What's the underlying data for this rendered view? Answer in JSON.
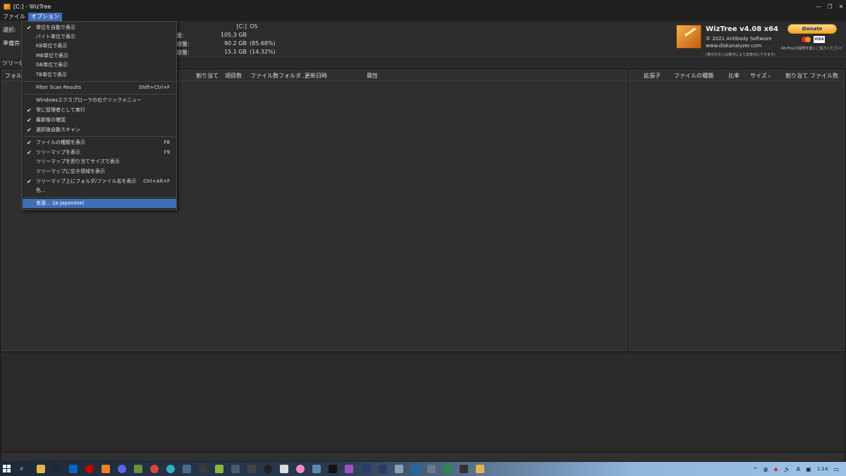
{
  "window": {
    "title": "[C:] - WizTree",
    "controls": {
      "minimize": "—",
      "maximize": "❐",
      "close": "✕"
    }
  },
  "menubar": {
    "file": "ファイル",
    "options": "オプション"
  },
  "info": {
    "select_label": "選択:",
    "ready_label": "準備完",
    "drive": {
      "row1": {
        "key": "",
        "value": "[C:]",
        "extra": "OS"
      },
      "row2": {
        "key": "量:",
        "value": "105.3 GB",
        "extra": ""
      },
      "row3": {
        "key": "容量:",
        "value": "90.2 GB",
        "extra": "(85.68%)"
      },
      "row4": {
        "key": "容量:",
        "value": "15.1 GB",
        "extra": "(14.32%)"
      }
    }
  },
  "brand": {
    "title": "WizTree v4.08 x64",
    "copyright": "© 2021 Antibody Software",
    "url": "www.diskanalyzer.com",
    "note": "(寄付ボタンは寄付により非表示にできます)"
  },
  "donate": {
    "label": "Donate",
    "visa": "VISA",
    "note": "WizTreeの開発支援にご協力ください!"
  },
  "tabs": {
    "tree": "ツリー表"
  },
  "left_columns": {
    "folder": "フォルダ",
    "allocated": "割り当て",
    "items": "項目数",
    "files": "ファイル数",
    "folders": "フォルダ...",
    "modified": "更新日時",
    "attributes": "属性"
  },
  "right_columns": {
    "ext": "拡張子",
    "type": "ファイルの種類",
    "ratio": "比率",
    "size": "サイズ",
    "allocated": "割り当て",
    "files": "ファイル数"
  },
  "options_menu": {
    "items": [
      {
        "label": "単位を自動で表示",
        "checked": "✔",
        "shortcut": ""
      },
      {
        "label": "バイト単位で表示",
        "checked": "",
        "shortcut": ""
      },
      {
        "label": "KB単位で表示",
        "checked": "",
        "shortcut": ""
      },
      {
        "label": "MB単位で表示",
        "checked": "",
        "shortcut": ""
      },
      {
        "label": "GB単位で表示",
        "checked": "",
        "shortcut": ""
      },
      {
        "label": "TB単位で表示",
        "checked": "",
        "shortcut": ""
      },
      {
        "label": "Filter Scan Results",
        "checked": "",
        "shortcut": "Shift+Ctrl+F"
      },
      {
        "label": "Windowsエクスプローラの右クリックメニュー",
        "checked": "",
        "shortcut": ""
      },
      {
        "label": "常に管理者として実行",
        "checked": "✔",
        "shortcut": ""
      },
      {
        "label": "最新版の確認",
        "checked": "✔",
        "shortcut": ""
      },
      {
        "label": "選択後自動スキャン",
        "checked": "✔",
        "shortcut": ""
      },
      {
        "label": "ファイルの種類を表示",
        "checked": "✔",
        "shortcut": "F8"
      },
      {
        "label": "ツリーマップを表示",
        "checked": "✔",
        "shortcut": "F9"
      },
      {
        "label": "ツリーマップを割り当てサイズで表示",
        "checked": "",
        "shortcut": ""
      },
      {
        "label": "ツリーマップに空き領域を表示",
        "checked": "",
        "shortcut": ""
      },
      {
        "label": "ツリーマップ上にフォルダ/ファイル名を表示",
        "checked": "✔",
        "shortcut": "Ctrl+Alt+F"
      },
      {
        "label": "色...",
        "checked": "",
        "shortcut": ""
      },
      {
        "label": "言語... (ja Japanese)",
        "checked": "",
        "shortcut": ""
      }
    ]
  },
  "tray": {
    "chevron": "^",
    "ime": "A",
    "time": "1:14"
  }
}
